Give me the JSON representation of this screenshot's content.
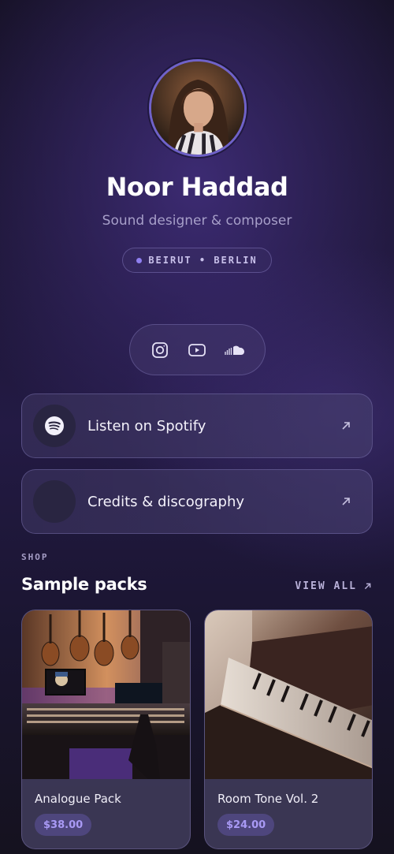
{
  "profile": {
    "name": "Noor Haddad",
    "tagline": "Sound designer & composer",
    "location": "BEIRUT • BERLIN",
    "accent": "#8f7ff0"
  },
  "social": {
    "icons": [
      "instagram-icon",
      "youtube-icon",
      "soundcloud-icon"
    ]
  },
  "links": [
    {
      "label": "Listen on Spotify",
      "icon": "spotify-icon"
    },
    {
      "label": "Credits & discography",
      "icon": ""
    }
  ],
  "shop": {
    "eyebrow": "SHOP",
    "title": "Sample packs",
    "view_all": "VIEW ALL",
    "products": [
      {
        "name": "Analogue Pack",
        "price": "$38.00",
        "image": "studio-photo"
      },
      {
        "name": "Room Tone Vol. 2",
        "price": "$24.00",
        "image": "piano-photo"
      }
    ]
  }
}
